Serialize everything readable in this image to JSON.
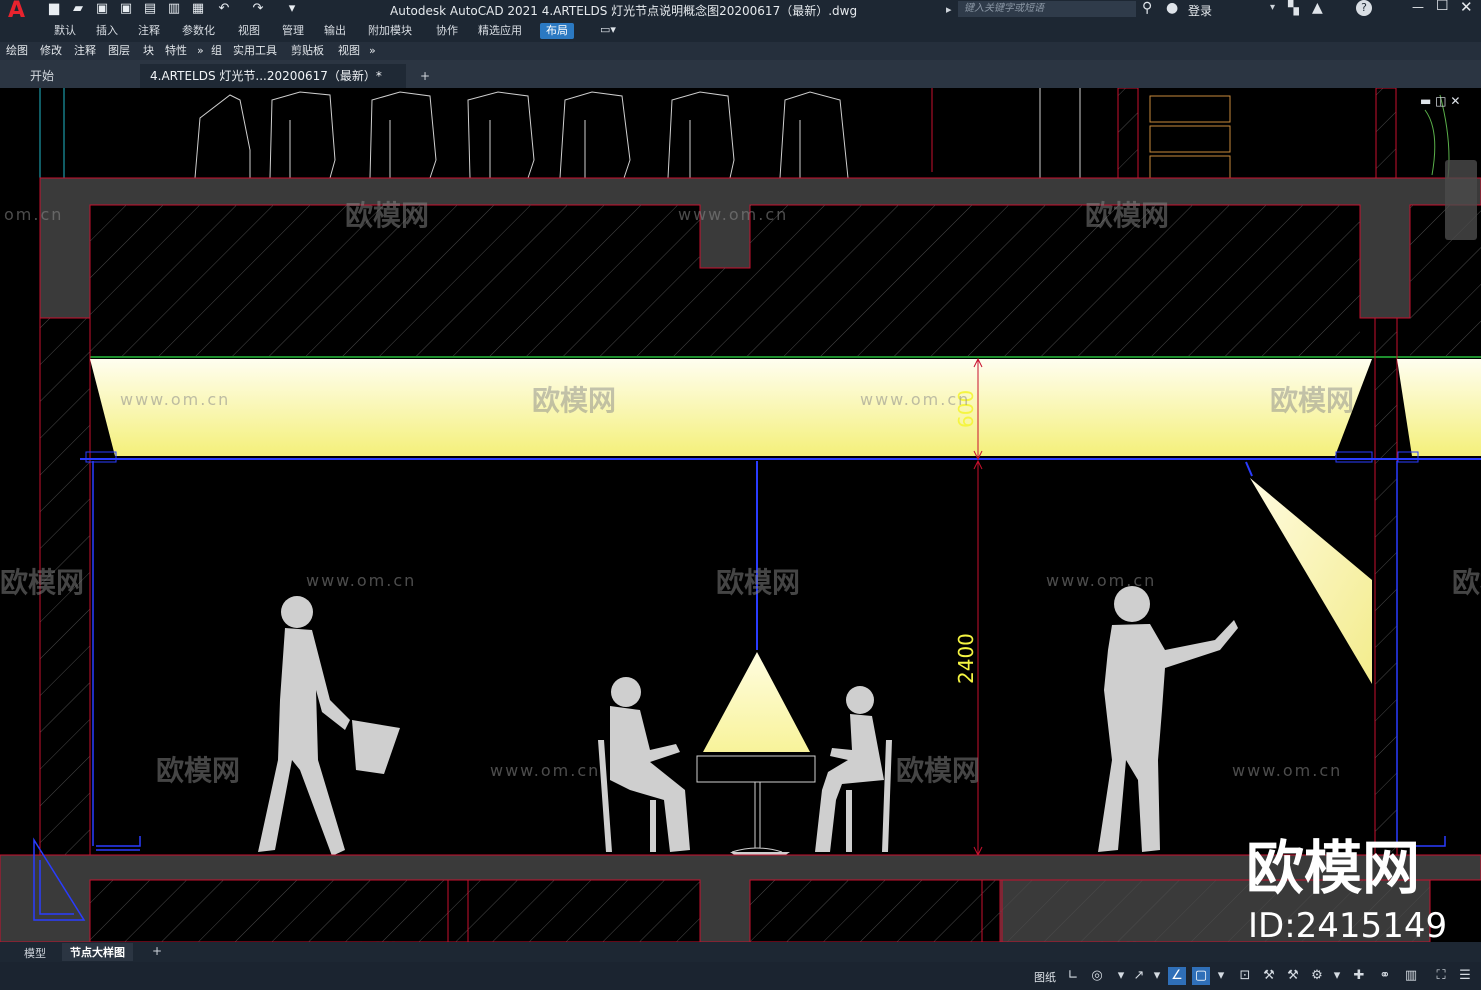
{
  "app": {
    "logo": "A",
    "title": "Autodesk AutoCAD 2021    4.ARTELDS 灯光节点说明概念图20200617（最新）.dwg",
    "search_placeholder": "键入关键字或短语",
    "login_label": "登录"
  },
  "ribbon_tabs": [
    "默认",
    "插入",
    "注释",
    "参数化",
    "视图",
    "管理",
    "输出",
    "附加模块",
    "协作",
    "精选应用",
    "布局"
  ],
  "ribbon_active_tab": "布局",
  "panel_menu": [
    "绘图",
    "修改",
    "注释",
    "图层",
    "块",
    "特性",
    "组",
    "实用工具",
    "剪贴板",
    "视图"
  ],
  "doc_tabs": {
    "start": "开始",
    "active": "4.ARTELDS 灯光节...20200617（最新）*",
    "new_tab": "+"
  },
  "drawing": {
    "dimension_ceiling": "600",
    "dimension_height": "2400"
  },
  "watermarks": {
    "url": "www.om.cn",
    "brand": "欧模网",
    "url_partial": "om.cn"
  },
  "overlay": {
    "brand_big": "欧模网",
    "id_text": "ID:2415149"
  },
  "layout_tabs": {
    "model": "模型",
    "layout": "节点大样图",
    "add": "+"
  },
  "status": {
    "paper": "图纸"
  },
  "colors": {
    "wall_red": "#c8102e",
    "light_yellow": "#fffbb0",
    "dim_yellow": "#f5f542",
    "cad_blue": "#2a3cff",
    "silhouette": "#cfcfcf",
    "ribbon_bg": "#1d2733"
  }
}
